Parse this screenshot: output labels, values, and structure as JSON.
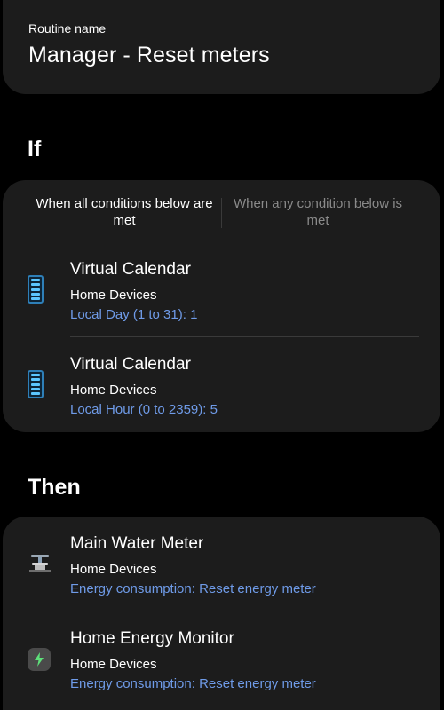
{
  "routine": {
    "label": "Routine name",
    "value": "Manager - Reset meters"
  },
  "if_section": {
    "title": "If",
    "toggle": {
      "all_label": "When all conditions below are met",
      "any_label": "When any condition below is met",
      "selected": "all"
    },
    "conditions": [
      {
        "icon": "virtual-calendar-icon",
        "title": "Virtual Calendar",
        "location": "Home Devices",
        "detail": "Local Day (1 to 31): 1"
      },
      {
        "icon": "virtual-calendar-icon",
        "title": "Virtual Calendar",
        "location": "Home Devices",
        "detail": "Local Hour (0 to 2359): 5"
      }
    ]
  },
  "then_section": {
    "title": "Then",
    "actions": [
      {
        "icon": "water-meter-icon",
        "title": "Main Water Meter",
        "location": "Home Devices",
        "detail": "Energy consumption: Reset energy meter"
      },
      {
        "icon": "energy-monitor-icon",
        "title": "Home Energy Monitor",
        "location": "Home Devices",
        "detail": "Energy consumption: Reset energy meter"
      }
    ]
  },
  "colors": {
    "background": "#000000",
    "card": "#1c1c1c",
    "link": "#6f9be8",
    "inactive_text": "#8a8a8a",
    "energy_green": "#5ee07a",
    "calendar_blue": "#5cc6ff"
  }
}
